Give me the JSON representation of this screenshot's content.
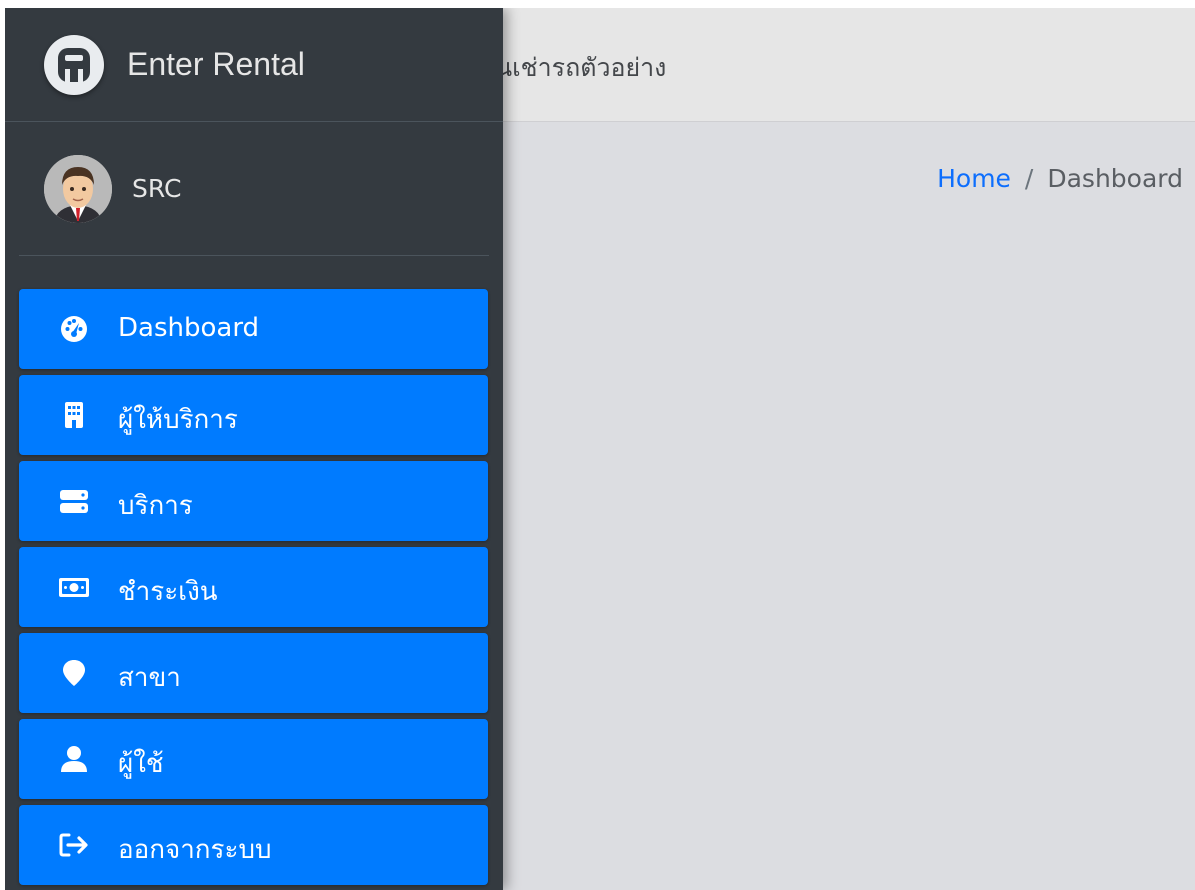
{
  "brand": {
    "name": "Enter Rental"
  },
  "topbar": {
    "title": "นเช่ารถตัวอย่าง"
  },
  "user": {
    "name": "SRC"
  },
  "breadcrumb": {
    "home": "Home",
    "separator": "/",
    "current": "Dashboard"
  },
  "sidebar": {
    "items": [
      {
        "label": "Dashboard",
        "icon": "tachometer-icon"
      },
      {
        "label": "ผู้ให้บริการ",
        "icon": "building-icon"
      },
      {
        "label": "บริการ",
        "icon": "server-icon"
      },
      {
        "label": "ชำระเงิน",
        "icon": "money-bill-icon"
      },
      {
        "label": "สาขา",
        "icon": "map-marker-icon"
      },
      {
        "label": "ผู้ใช้",
        "icon": "user-icon"
      },
      {
        "label": "ออกจากระบบ",
        "icon": "sign-out-icon"
      }
    ]
  },
  "colors": {
    "sidebar_bg": "#343a40",
    "nav_item_bg": "#007bff",
    "content_bg": "#dcdde1",
    "topbar_bg": "#e6e6e6",
    "link": "#0d6efd"
  }
}
